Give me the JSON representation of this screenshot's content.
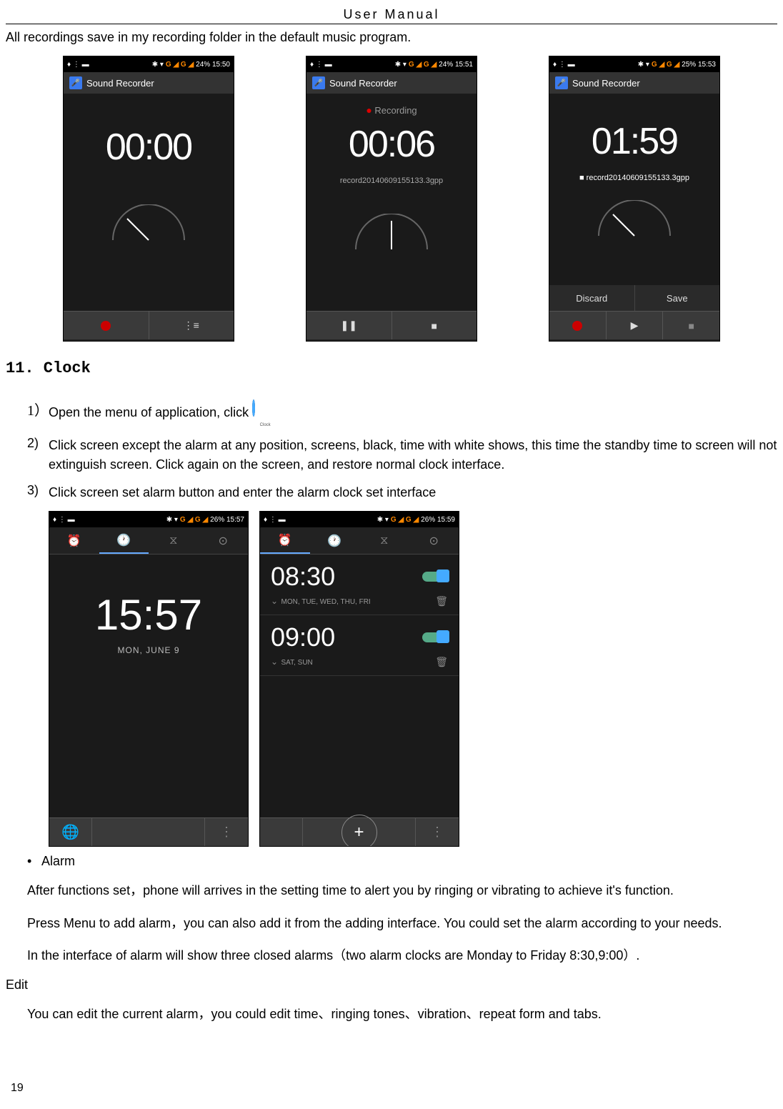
{
  "header": "User    Manual",
  "intro": "All recordings save in my recording folder in the default music program.",
  "section_title": "11. Clock",
  "steps": {
    "s1_num": "1）",
    "s1": "Open the menu of application, click",
    "s1_icon_label": "Clock",
    "s2_num": "2)",
    "s2": "Click screen except the alarm at any position, screens, black, time with white shows, this time the standby time to screen will not extinguish screen. Click again on the screen, and restore normal clock interface.",
    "s3_num": "3)",
    "s3": "Click screen set alarm button and enter the alarm clock set interface"
  },
  "bullet": "Alarm",
  "para1": "After functions set，phone will arrives in the setting time to alert you by ringing or vibrating to achieve it's function.",
  "para2": "Press Menu to add alarm，you can also add it from the adding interface. You could set the alarm according to your needs.",
  "para3": "In the interface of alarm will show three closed alarms（two alarm clocks are Monday to Friday 8:30,9:00）.",
  "edit_label": "Edit",
  "para4": "You can edit the current alarm，you could edit time、ringing tones、vibration、repeat form and tabs.",
  "page_num": "19",
  "phones": {
    "rec1": {
      "status_right": "24%  15:50",
      "app_title": "Sound Recorder",
      "timer": "00:00"
    },
    "rec2": {
      "status_right": "24%  15:51",
      "app_title": "Sound Recorder",
      "rec_label": "Recording",
      "timer": "00:06",
      "filename": "record20140609155133.3gpp"
    },
    "rec3": {
      "status_right": "25%  15:53",
      "app_title": "Sound Recorder",
      "timer": "01:59",
      "filename": "record20140609155133.3gpp",
      "discard": "Discard",
      "save": "Save"
    },
    "clock1": {
      "status_right": "26%  15:57",
      "time": "15:57",
      "date": "MON, JUNE 9"
    },
    "clock2": {
      "status_right": "26%  15:59",
      "a1_time": "08:30",
      "a1_days": "MON, TUE, WED, THU, FRI",
      "a2_time": "09:00",
      "a2_days": "SAT, SUN"
    },
    "status_left": "♦ ⋮ ▬",
    "signal_g": "G ◢ G ◢"
  }
}
